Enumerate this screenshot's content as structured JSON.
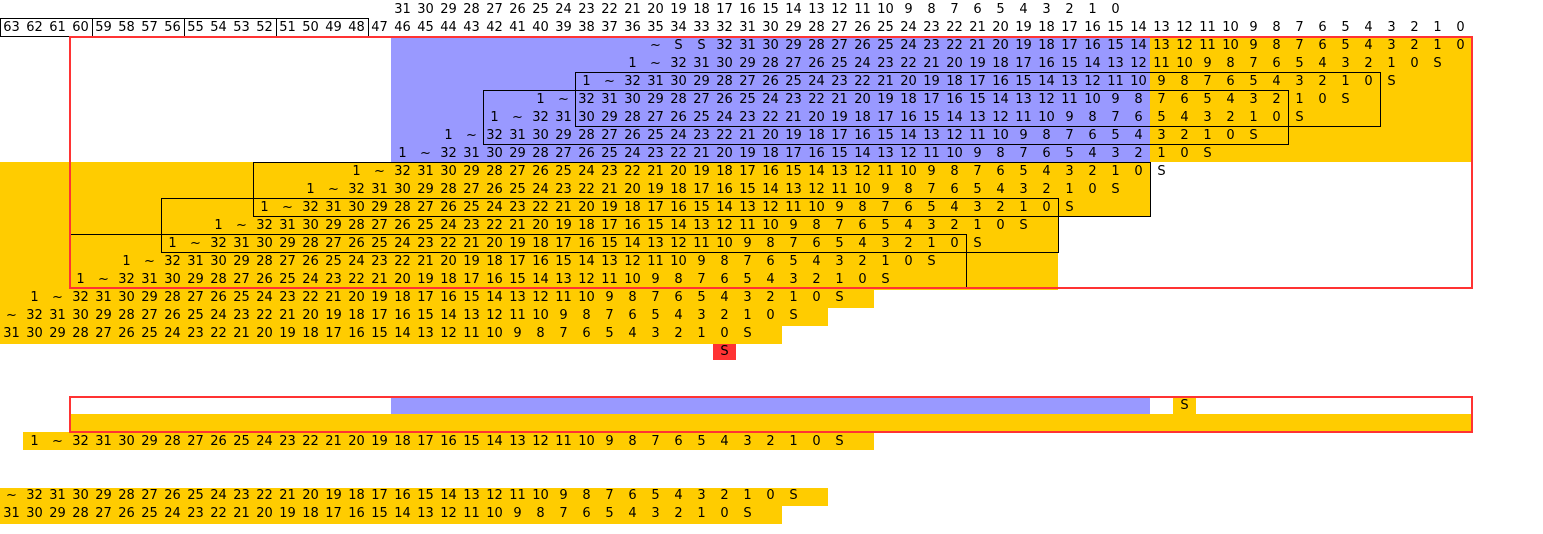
{
  "colors": {
    "gold": "#ffcc00",
    "blue": "#9999ff",
    "red": "#ff3333",
    "box": "#000000",
    "white": "#ffffff"
  },
  "header": {
    "top_row": "31 30 29 28 27 26 25 24 23 22 21 20 19 18 17 16 15 14 13 12 11 10 9 8 7 6 5 4 3 2 1 0",
    "bottom_row": "63 62 61 60 59 58 57 56 55 54 53 52 51 50 49 48 47 46 45 44 43 42 41 40 39 38 37 36 35 34 33 32 31 30 29 28 27 26 25 24 23 22 21 20 19 18 17 16 15 14 13 12 11 10 9 8 7 6 5 4 3 2 1 0"
  },
  "rows": {
    "r1": "~ S S 32 31 30 29 28 27 26 25 24 23 22 21 20 19 18 17 16 15 14 13 12 11 10 9 8 7 6 5 4 3 2 1 0",
    "r2": "1 ~ 32 31 30 29 28 27 26 25 24 23 22 21 20 19 18 17 16 15 14 13 12 11 10 9 8 7 6 5 4 3 2 1 0 S",
    "r3": "1 ~ 32 31 30 29 28 27 26 25 24 23 22 21 20 19 18 17 16 15 14 13 12 11 10 9 8 7 6 5 4 3 2 1 0 S",
    "r4": "1 ~ 32 31 30 29 28 27 26 25 24 23 22 21 20 19 18 17 16 15 14 13 12 11 10 9 8 7 6 5 4 3 2 1 0 S",
    "r5": "1 ~ 32 31 30 29 28 27 26 25 24 23 22 21 20 19 18 17 16 15 14 13 12 11 10 9 8 7 6 5 4 3 2 1 0 S",
    "r6": "1 ~ 32 31 30 29 28 27 26 25 24 23 22 21 20 19 18 17 16 15 14 13 12 11 10 9 8 7 6 5 4 3 2 1 0 S",
    "r7": "1 ~ 32 31 30 29 28 27 26 25 24 23 22 21 20 19 18 17 16 15 14 13 12 11 10 9 8 7 6 5 4 3 2 1 0 S",
    "r8": "1 ~ 32 31 30 29 28 27 26 25 24 23 22 21 20 19 18 17 16 15 14 13 12 11 10 9 8 7 6 5 4 3 2 1 0 S",
    "r9": "1 ~ 32 31 30 29 28 27 26 25 24 23 22 21 20 19 18 17 16 15 14 13 12 11 10 9 8 7 6 5 4 3 2 1 0 S",
    "r10": "1 ~ 32 31 30 29 28 27 26 25 24 23 22 21 20 19 18 17 16 15 14 13 12 11 10 9 8 7 6 5 4 3 2 1 0 S",
    "r11": "1 ~ 32 31 30 29 28 27 26 25 24 23 22 21 20 19 18 17 16 15 14 13 12 11 10 9 8 7 6 5 4 3 2 1 0 S",
    "r12": "1 ~ 32 31 30 29 28 27 26 25 24 23 22 21 20 19 18 17 16 15 14 13 12 11 10 9 8 7 6 5 4 3 2 1 0 S",
    "r13": "1 ~ 32 31 30 29 28 27 26 25 24 23 22 21 20 19 18 17 16 15 14 13 12 11 10 9 8 7 6 5 4 3 2 1 0 S",
    "r14": "1 ~ 32 31 30 29 28 27 26 25 24 23 22 21 20 19 18 17 16 15 14 13 12 11 10 9 8 7 6 5 4 3 2 1 0 S",
    "r15": "~ 32 31 30 29 28 27 26 25 24 23 22 21 20 19 18 17 16 15 14 13 12 11 10 9 8 7 6 5 4 3 2 1 0 S",
    "r16": "31 30 29 28 27 26 25 24 23 22 21 20 19 18 17 16 15 14 13 12 11 10 9 8 7 6 5 4 3 2 1 0 S",
    "r_s": "S",
    "r_s2": "S",
    "r18": "1 ~ 32 31 30 29 28 27 26 25 24 23 22 21 20 19 18 17 16 15 14 13 12 11 10 9 8 7 6 5 4 3 2 1 0 S",
    "r19": "~ 32 31 30 29 28 27 26 25 24 23 22 21 20 19 18 17 16 15 14 13 12 11 10 9 8 7 6 5 4 3 2 1 0 S",
    "r20": "31 30 29 28 27 26 25 24 23 22 21 20 19 18 17 16 15 14 13 12 11 10 9 8 7 6 5 4 3 2 1 0 S"
  }
}
